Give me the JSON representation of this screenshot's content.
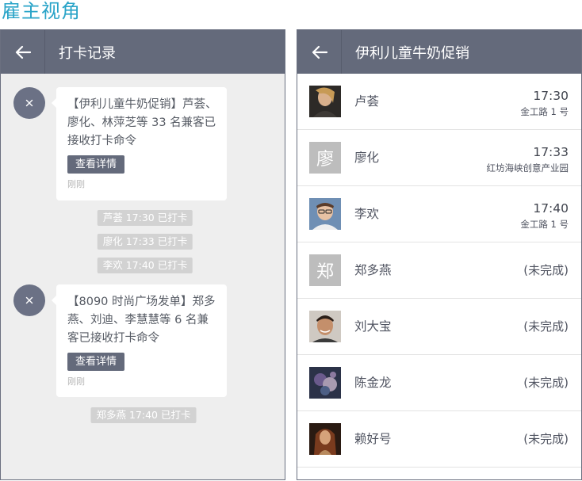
{
  "page_heading": "雇主视角",
  "left": {
    "title": "打卡记录",
    "messages": [
      {
        "text": "【伊利儿童牛奶促销】芦荟、廖化、林萍芝等 33 名兼客已接收打卡命令",
        "button": "查看详情",
        "time": "刚刚"
      },
      {
        "text": "【8090 时尚广场发单】郑多燕、刘迪、李慧慧等 6 名兼客已接收打卡命令",
        "button": "查看详情",
        "time": "刚刚"
      }
    ],
    "chips": [
      "芦荟 17:30 已打卡",
      "廖化 17:33 已打卡",
      "李欢 17:40 已打卡",
      "郑多燕 17:40 已打卡"
    ]
  },
  "right": {
    "title": "伊利儿童牛奶促销",
    "rows": [
      {
        "name": "卢荟",
        "time": "17:30",
        "location": "金工路 1 号"
      },
      {
        "name": "廖化",
        "avatar_letter": "廖",
        "time": "17:33",
        "location": "红坊海峡创意产业园"
      },
      {
        "name": "李欢",
        "time": "17:40",
        "location": "金工路 1 号"
      },
      {
        "name": "郑多燕",
        "avatar_letter": "郑",
        "status": "(未完成)"
      },
      {
        "name": "刘大宝",
        "status": "(未完成)"
      },
      {
        "name": "陈金龙",
        "status": "(未完成)"
      },
      {
        "name": "赖好号",
        "status": "(未完成)"
      }
    ]
  },
  "colors": {
    "heading": "#2aa4c8",
    "appbar": "#646a7b",
    "chip": "#d2d2d2",
    "left_background": "#eeeeee"
  }
}
